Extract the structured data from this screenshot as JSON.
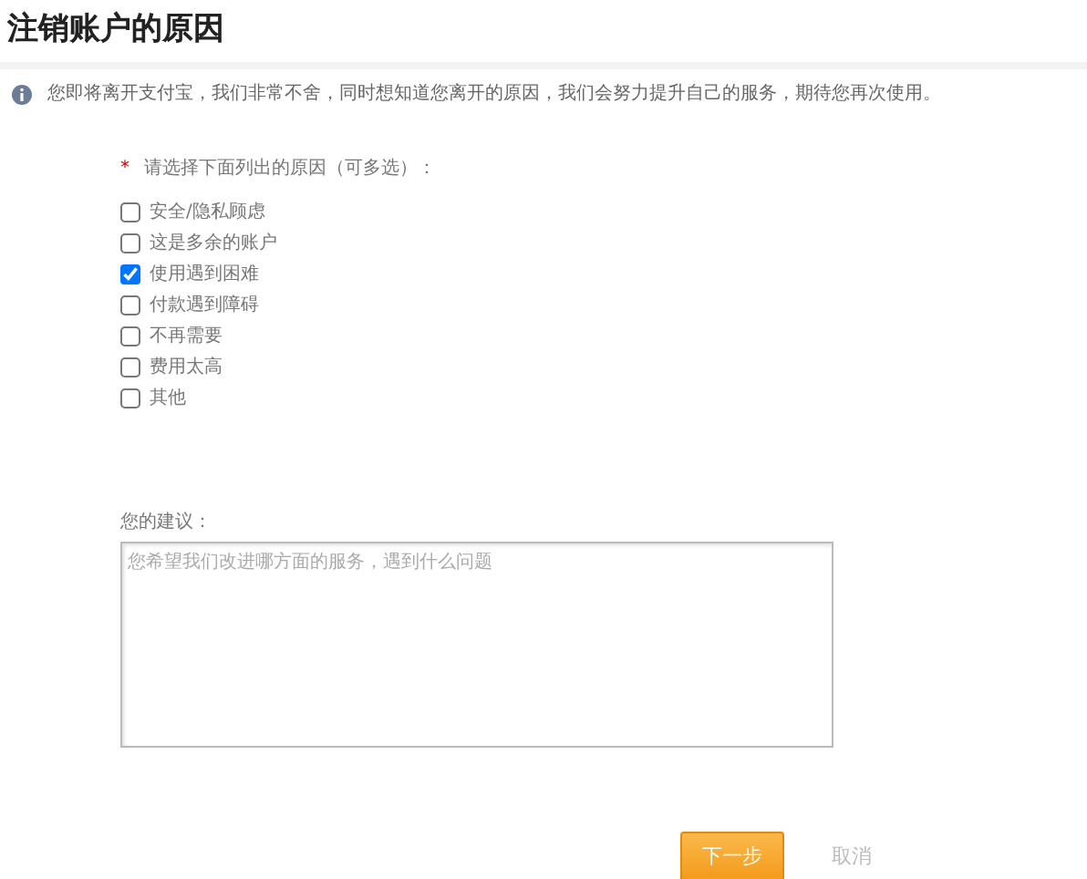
{
  "title": "注销账户的原因",
  "notice": "您即将离开支付宝，我们非常不舍，同时想知道您离开的原因，我们会努力提升自己的服务，期待您再次使用。",
  "reasons": {
    "required_mark": "*",
    "label": "请选择下面列出的原因（可多选）：",
    "options": [
      {
        "label": "安全/隐私顾虑",
        "checked": false
      },
      {
        "label": "这是多余的账户",
        "checked": false
      },
      {
        "label": "使用遇到困难",
        "checked": true
      },
      {
        "label": "付款遇到障碍",
        "checked": false
      },
      {
        "label": "不再需要",
        "checked": false
      },
      {
        "label": "费用太高",
        "checked": false
      },
      {
        "label": "其他",
        "checked": false
      }
    ]
  },
  "suggestion": {
    "label": "您的建议：",
    "placeholder": "您希望我们改进哪方面的服务，遇到什么问题"
  },
  "buttons": [
    {
      "kind": "primary",
      "label": "下一步"
    },
    {
      "kind": "link",
      "label": "取消"
    }
  ]
}
